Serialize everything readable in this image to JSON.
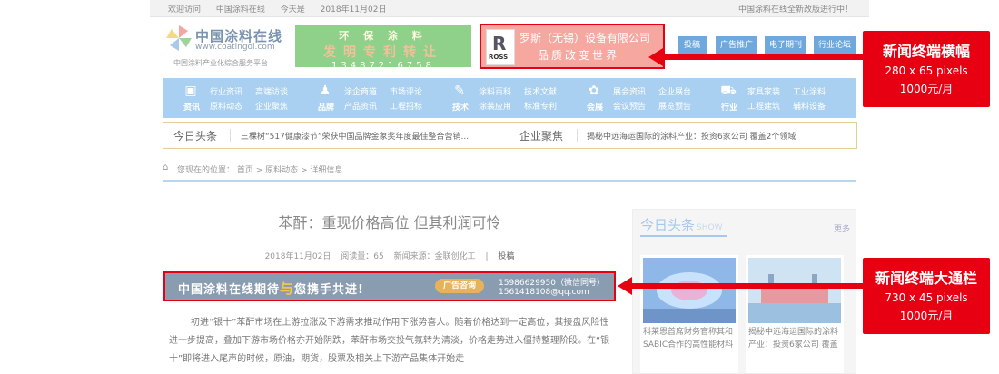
{
  "topbar": {
    "welcome": "欢迎访问",
    "site": "中国涂料在线",
    "today_label": "今天是",
    "date": "2018年11月02日",
    "notice": "中国涂料在线全新改版进行中！"
  },
  "logo": {
    "name": "中国涂料在线",
    "url": "www.coatingol.com",
    "sub": "中国涂料产业化综合服务平台"
  },
  "banner_patent": {
    "line1": "环 保 涂 料",
    "line2": "发明专利转让",
    "phone": "13487216758"
  },
  "banner_ross": {
    "brand": "ROSS",
    "company": "罗斯（无锡）设备有限公司",
    "slogan": "品质改变世界"
  },
  "header_buttons": [
    "投稿",
    "广告推广",
    "电子期刊",
    "行业论坛"
  ],
  "nav": [
    {
      "icon": "news-icon",
      "category": "资讯",
      "items": [
        "行业资讯",
        "高端访谈",
        "原料动态",
        "企业聚焦"
      ]
    },
    {
      "icon": "brand-icon",
      "category": "品牌",
      "items": [
        "涂企商道",
        "市场评论",
        "产品资讯",
        "工程招标"
      ]
    },
    {
      "icon": "tech-icon",
      "category": "技术",
      "items": [
        "涂料百科",
        "技术文献",
        "涂装应用",
        "标准专利"
      ]
    },
    {
      "icon": "expo-icon",
      "category": "会展",
      "items": [
        "展会资讯",
        "企业展台",
        "会议预告",
        "展览预告"
      ]
    },
    {
      "icon": "cart-icon",
      "category": "行业",
      "items": [
        "家具家装",
        "工业涂料",
        "工程建筑",
        "辅料设备"
      ]
    }
  ],
  "headline_bar": {
    "label1": "今日头条",
    "news1": "三棵树“517健康漆节”荣获中国品牌金象奖年度最佳整合营销...",
    "label2": "企业聚焦",
    "news2": "揭秘中远海运国际的涂料产业：投资6家公司 覆盖2个领域"
  },
  "breadcrumb": {
    "prefix": "您现在的位置：",
    "path": "首页  >  原料动态  >  详细信息"
  },
  "article": {
    "title": "苯酐：重现价格高位 但其利润可怜",
    "date": "2018年11月02日",
    "reads": "阅读量：65",
    "source": "新闻来源：金联创化工",
    "divider": "|",
    "submit": "投稿",
    "paragraph": "初进“银十”苯酐市场在上游拉涨及下游需求推动作用下涨势喜人。随着价格达到一定高位，其接盘风险性进一步提高，叠加下游市场价格亦开始阴跌，苯酐市场交投气氛转为清淡，价格走势进入僵持整理阶段。在“银十”即将进入尾声的时候，原油，期货，股票及相关上下游产品集体开始走"
  },
  "ad_banner": {
    "text_a": "中国涂料在线期待",
    "text_b": "与",
    "text_c": "您携手共进!",
    "button": "广告咨询",
    "phone": "15986629950（微信同号）",
    "email": "1561418108@qq.com"
  },
  "sidebar": {
    "title": "今日头条",
    "title_en": "SHOW",
    "more": "更多",
    "cards": [
      {
        "caption": "科莱恩首席财务官称其和SABIC合作的高性能材料"
      },
      {
        "caption": "揭秘中远海运国际的涂料产业：投资6家公司 覆盖"
      }
    ]
  },
  "callouts": [
    {
      "title": "新闻终端横幅",
      "size": "280 x 65 pixels",
      "price": "1000元/月"
    },
    {
      "title": "新闻终端大通栏",
      "size": "730 x 45 pixels",
      "price": "1000元/月"
    }
  ],
  "colors": {
    "accent_red": "#e60012",
    "nav_blue": "#a9d0f0",
    "button_blue": "#6fa8dc"
  }
}
